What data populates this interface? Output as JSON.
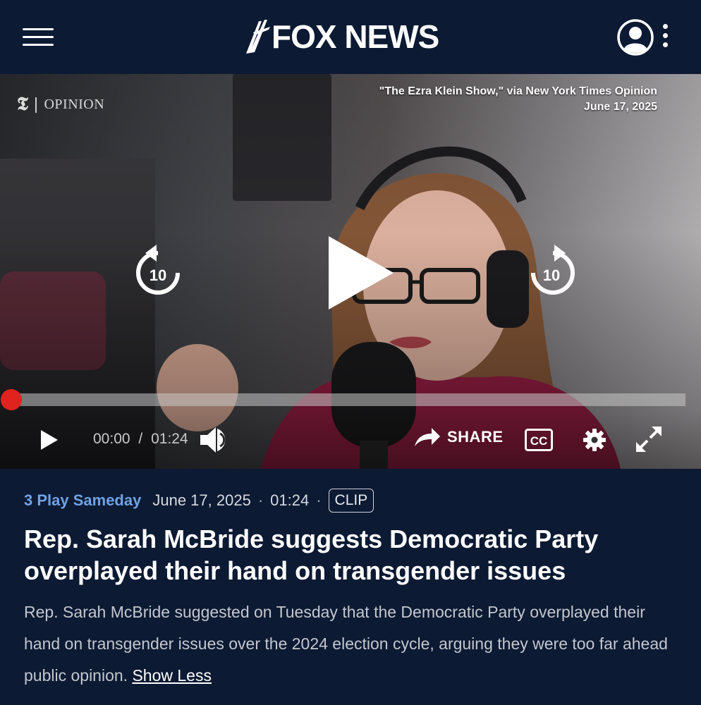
{
  "header": {
    "brand": "FOX NEWS",
    "menu_icon": "hamburger-menu-icon",
    "account_icon": "account-icon",
    "more_icon": "more-vertical-icon"
  },
  "video": {
    "source_logo": "OPINION",
    "credit_line1": "\"The Ezra Klein Show,\" via New York Times Opinion",
    "credit_line2": "June 17, 2025",
    "rewind_label": "10",
    "forward_label": "10",
    "current_time": "00:00",
    "duration": "01:24",
    "time_separator": "/",
    "progress": 0,
    "share_label": "SHARE",
    "cc_label": "CC",
    "accent_color": "#e0231e"
  },
  "article": {
    "show_name": "3 Play Sameday",
    "date": "June 17, 2025",
    "length": "01:24",
    "badge": "CLIP",
    "headline": "Rep. Sarah McBride suggests Democratic Party overplayed their hand on transgender issues",
    "description": "Rep. Sarah McBride suggested on Tuesday that the Democratic Party overplayed their hand on transgender issues over the 2024 election cycle, arguing they were too far ahead public opinion.",
    "show_less": "Show Less"
  }
}
